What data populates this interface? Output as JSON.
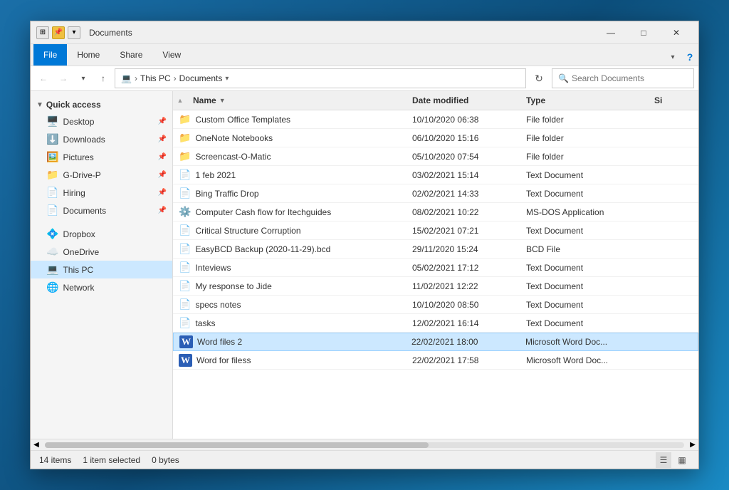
{
  "window": {
    "title": "Documents",
    "minimize": "—",
    "maximize": "□",
    "close": "✕"
  },
  "ribbon": {
    "tabs": [
      "File",
      "Home",
      "Share",
      "View"
    ]
  },
  "addressbar": {
    "path": [
      "This PC",
      "Documents"
    ],
    "search_placeholder": "Search Documents",
    "refresh_label": "↻"
  },
  "sidebar": {
    "quick_access_label": "Quick access",
    "items": [
      {
        "name": "Desktop",
        "icon": "🖥️",
        "pinned": true
      },
      {
        "name": "Downloads",
        "icon": "⬇️",
        "pinned": true
      },
      {
        "name": "Pictures",
        "icon": "🖼️",
        "pinned": true
      },
      {
        "name": "G-Drive-P",
        "icon": "📁",
        "pinned": true
      },
      {
        "name": "Hiring",
        "icon": "📄",
        "pinned": true
      },
      {
        "name": "Documents",
        "icon": "📄",
        "pinned": true
      }
    ],
    "other_items": [
      {
        "name": "Dropbox",
        "icon": "💠"
      },
      {
        "name": "OneDrive",
        "icon": "☁️"
      },
      {
        "name": "This PC",
        "icon": "💻",
        "active": true
      },
      {
        "name": "Network",
        "icon": "🌐"
      }
    ]
  },
  "columns": {
    "name": "Name",
    "date_modified": "Date modified",
    "type": "Type",
    "size": "Si"
  },
  "files": [
    {
      "name": "Custom Office Templates",
      "date": "10/10/2020 06:38",
      "type": "File folder",
      "size": "",
      "icon": "📁",
      "icon_color": "#e6a817",
      "selected": false
    },
    {
      "name": "OneNote Notebooks",
      "date": "06/10/2020 15:16",
      "type": "File folder",
      "size": "",
      "icon": "📁",
      "icon_color": "#e6a817",
      "selected": false
    },
    {
      "name": "Screencast-O-Matic",
      "date": "05/10/2020 07:54",
      "type": "File folder",
      "size": "",
      "icon": "📁",
      "icon_color": "#e6a817",
      "selected": false
    },
    {
      "name": "1 feb 2021",
      "date": "03/02/2021 15:14",
      "type": "Text Document",
      "size": "",
      "icon": "📄",
      "icon_color": "#666",
      "selected": false
    },
    {
      "name": "Bing Traffic Drop",
      "date": "02/02/2021 14:33",
      "type": "Text Document",
      "size": "",
      "icon": "📄",
      "icon_color": "#666",
      "selected": false
    },
    {
      "name": "Computer Cash flow for Itechguides",
      "date": "08/02/2021 10:22",
      "type": "MS-DOS Application",
      "size": "",
      "icon": "⚙️",
      "icon_color": "#888",
      "selected": false
    },
    {
      "name": "Critical Structure Corruption",
      "date": "15/02/2021 07:21",
      "type": "Text Document",
      "size": "",
      "icon": "📄",
      "icon_color": "#666",
      "selected": false
    },
    {
      "name": "EasyBCD Backup (2020-11-29).bcd",
      "date": "29/11/2020 15:24",
      "type": "BCD File",
      "size": "",
      "icon": "📄",
      "icon_color": "#666",
      "selected": false
    },
    {
      "name": "Inteviews",
      "date": "05/02/2021 17:12",
      "type": "Text Document",
      "size": "",
      "icon": "📄",
      "icon_color": "#666",
      "selected": false
    },
    {
      "name": "My response to Jide",
      "date": "11/02/2021 12:22",
      "type": "Text Document",
      "size": "",
      "icon": "📄",
      "icon_color": "#666",
      "selected": false
    },
    {
      "name": "specs notes",
      "date": "10/10/2020 08:50",
      "type": "Text Document",
      "size": "",
      "icon": "📄",
      "icon_color": "#666",
      "selected": false
    },
    {
      "name": "tasks",
      "date": "12/02/2021 16:14",
      "type": "Text Document",
      "size": "",
      "icon": "📄",
      "icon_color": "#666",
      "selected": false
    },
    {
      "name": "Word files 2",
      "date": "22/02/2021 18:00",
      "type": "Microsoft Word Doc...",
      "size": "",
      "icon": "W",
      "icon_color": "#2b5eb5",
      "selected": true
    },
    {
      "name": "Word for filess",
      "date": "22/02/2021 17:58",
      "type": "Microsoft Word Doc...",
      "size": "",
      "icon": "W",
      "icon_color": "#2b5eb5",
      "selected": false
    }
  ],
  "statusbar": {
    "item_count": "14 items",
    "selected": "1 item selected",
    "size": "0 bytes"
  }
}
